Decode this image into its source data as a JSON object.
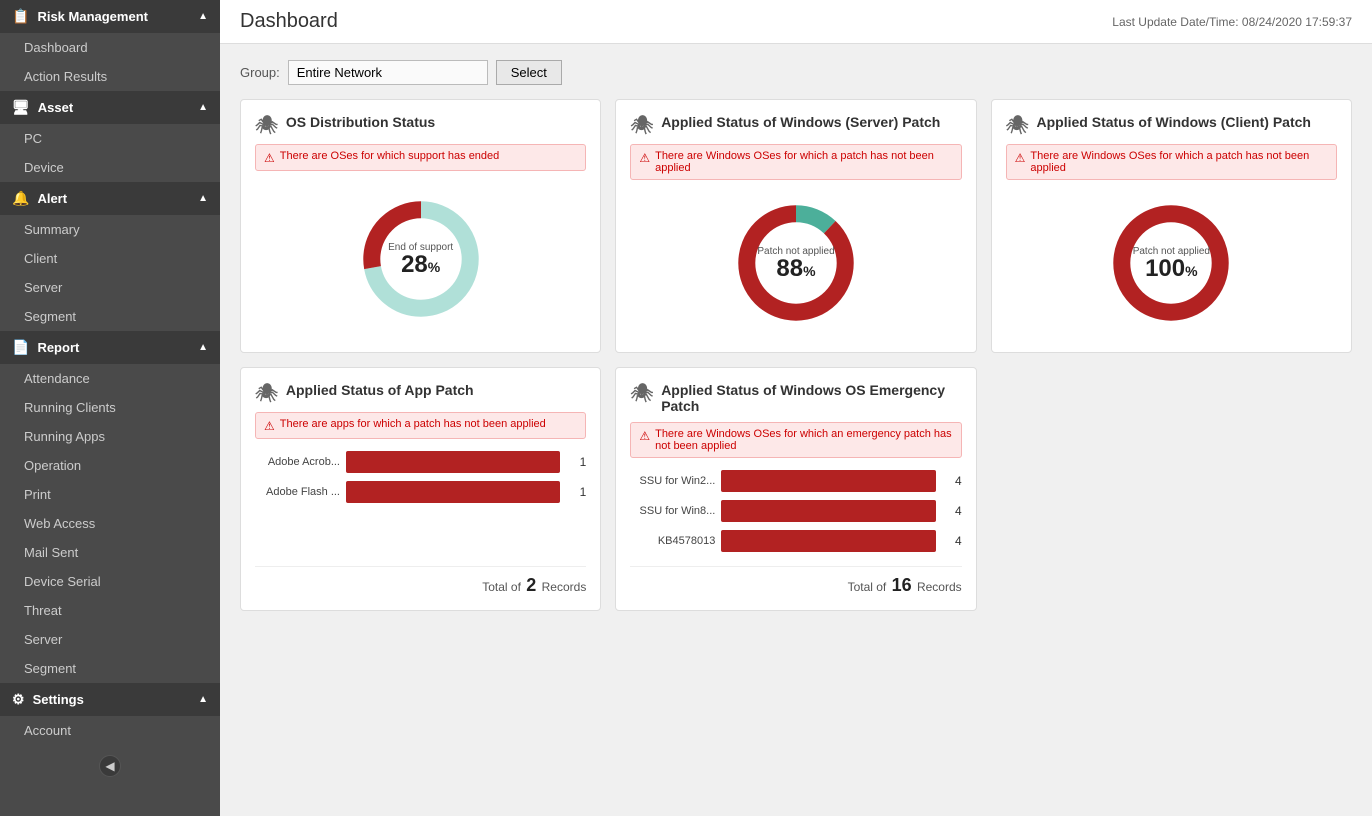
{
  "sidebar": {
    "sections": [
      {
        "id": "risk-management",
        "label": "Risk Management",
        "icon": "📋",
        "items": [
          "Dashboard",
          "Action Results"
        ]
      },
      {
        "id": "asset",
        "label": "Asset",
        "icon": "🖥",
        "items": [
          "PC",
          "Device"
        ]
      },
      {
        "id": "alert",
        "label": "Alert",
        "icon": "🔔",
        "items": [
          "Summary",
          "Client",
          "Server",
          "Segment"
        ]
      },
      {
        "id": "report",
        "label": "Report",
        "icon": "📄",
        "items": [
          "Attendance",
          "Running Clients",
          "Running Apps",
          "Operation",
          "Print",
          "Web Access",
          "Mail Sent",
          "Device Serial",
          "Threat",
          "Server",
          "Segment"
        ]
      },
      {
        "id": "settings",
        "label": "Settings",
        "icon": "⚙",
        "items": [
          "Account"
        ]
      }
    ],
    "collapse_label": "◀"
  },
  "header": {
    "title": "Dashboard",
    "timestamp_label": "Last Update Date/Time:",
    "timestamp_value": "08/24/2020 17:59:37"
  },
  "group_bar": {
    "label": "Group:",
    "value": "Entire Network",
    "button_label": "Select"
  },
  "cards": {
    "row1": [
      {
        "id": "os-dist",
        "title": "OS Distribution Status",
        "alert": "There are OSes for which support has ended",
        "type": "donut",
        "donut": {
          "center_label": "End of support",
          "value": "28",
          "unit": "%",
          "segments": [
            {
              "color": "#b0e0d8",
              "percent": 72
            },
            {
              "color": "#b22222",
              "percent": 28
            }
          ]
        }
      },
      {
        "id": "win-server-patch",
        "title": "Applied Status of Windows (Server) Patch",
        "alert": "There are Windows OSes for which a patch has not been applied",
        "type": "donut",
        "donut": {
          "center_label": "Patch not applied",
          "value": "88",
          "unit": "%",
          "segments": [
            {
              "color": "#4caf9a",
              "percent": 12
            },
            {
              "color": "#b22222",
              "percent": 88
            }
          ]
        }
      },
      {
        "id": "win-client-patch",
        "title": "Applied Status of Windows (Client) Patch",
        "alert": "There are Windows OSes for which a patch has not been applied",
        "type": "donut",
        "donut": {
          "center_label": "Patch not applied",
          "value": "100",
          "unit": "%",
          "segments": [
            {
              "color": "#b22222",
              "percent": 100
            },
            {
              "color": "#b22222",
              "percent": 0
            }
          ]
        }
      }
    ],
    "row2": [
      {
        "id": "app-patch",
        "title": "Applied Status of App Patch",
        "alert": "There are apps for which a patch has not been applied",
        "type": "bar",
        "bars": [
          {
            "label": "Adobe Acrob...",
            "value": 1,
            "max": 1
          },
          {
            "label": "Adobe Flash ...",
            "value": 1,
            "max": 1
          }
        ],
        "footer_total": "2"
      },
      {
        "id": "win-emergency",
        "title": "Applied Status of Windows OS Emergency Patch",
        "alert": "There are Windows OSes for which an emergency patch has not been applied",
        "type": "bar",
        "bars": [
          {
            "label": "SSU for Win2...",
            "value": 4,
            "max": 4
          },
          {
            "label": "SSU for Win8...",
            "value": 4,
            "max": 4
          },
          {
            "label": "KB4578013",
            "value": 4,
            "max": 4
          }
        ],
        "footer_total": "16"
      },
      {
        "id": "empty",
        "type": "empty"
      }
    ]
  }
}
